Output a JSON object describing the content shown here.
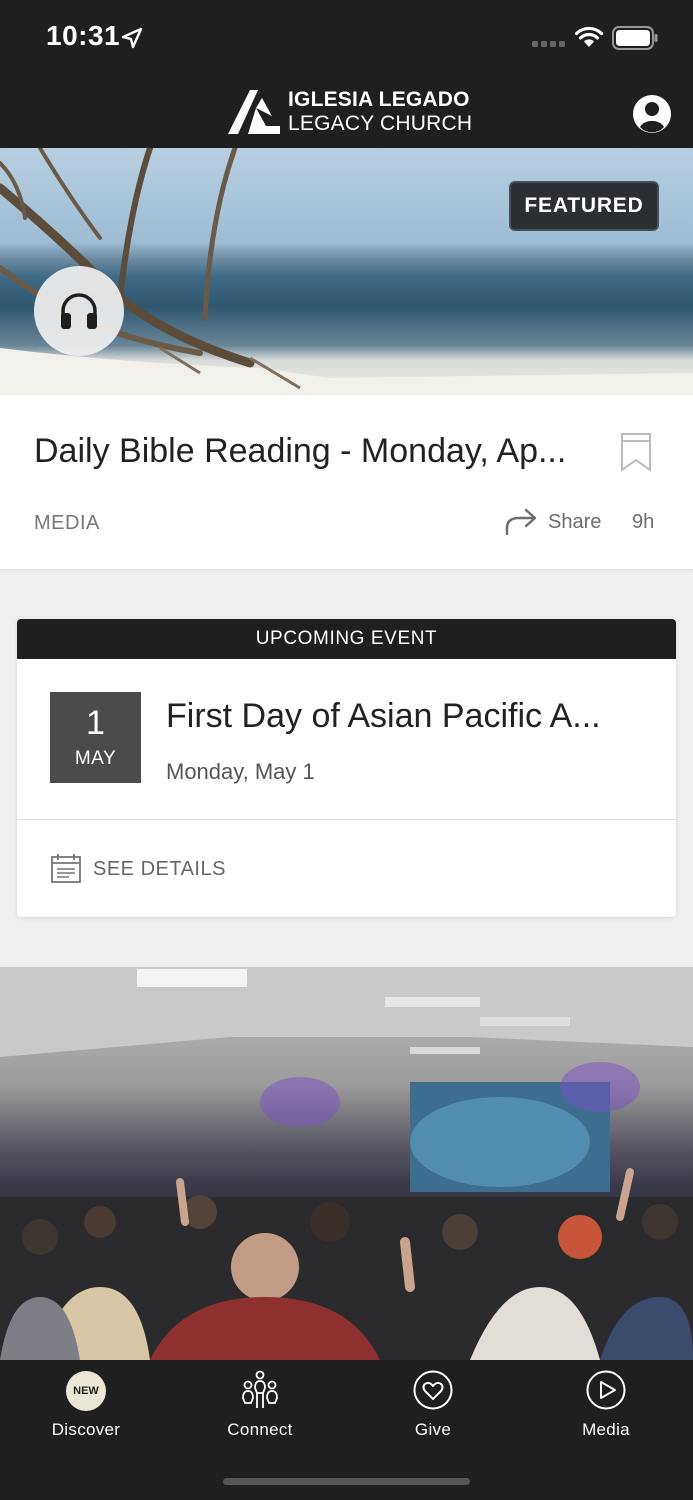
{
  "status_bar": {
    "time": "10:31"
  },
  "header": {
    "logo_line1": "IGLESIA LEGADO",
    "logo_line2": "LEGACY CHURCH"
  },
  "featured": {
    "badge": "FEATURED",
    "title": "Daily Bible Reading - Monday, Ap...",
    "category": "MEDIA",
    "share_label": "Share",
    "time_ago": "9h"
  },
  "event": {
    "header": "UPCOMING EVENT",
    "day": "1",
    "month": "MAY",
    "title": "First Day of Asian Pacific A...",
    "date_text": "Monday, May 1",
    "details_label": "SEE DETAILS"
  },
  "tabs": [
    {
      "label": "Discover",
      "badge": "NEW",
      "icon": "new-badge-icon"
    },
    {
      "label": "Connect",
      "icon": "people-connect-icon"
    },
    {
      "label": "Give",
      "icon": "heart-circle-icon"
    },
    {
      "label": "Media",
      "icon": "play-circle-icon"
    }
  ],
  "colors": {
    "bar": "#1f1f1f",
    "date_block": "#4b4b4b",
    "background": "#efefef"
  }
}
